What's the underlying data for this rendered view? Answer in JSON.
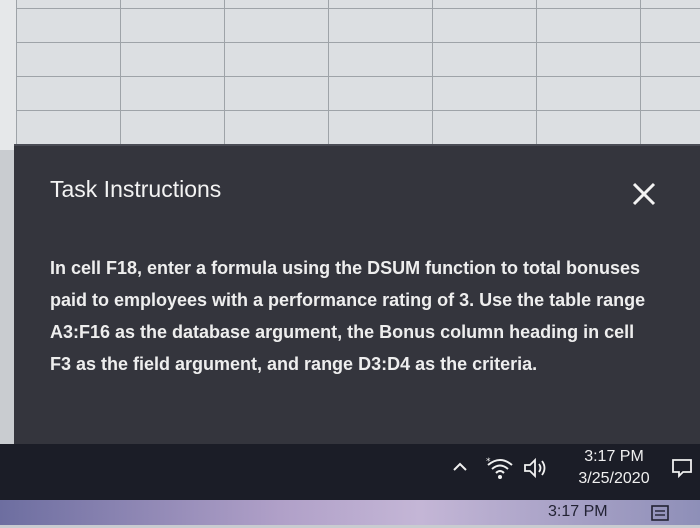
{
  "dialog": {
    "title": "Task Instructions",
    "close_icon": "close-icon",
    "instructions": "In cell F18, enter a formula using the DSUM function to total bonuses paid to employees with a performance rating of 3. Use the table range A3:F16 as the database argument, the Bonus column heading in cell F3 as the field argument, and range D3:D4 as the criteria."
  },
  "taskbar": {
    "time": "3:17 PM",
    "date": "3/25/2020",
    "icons": [
      "chevron-up-icon",
      "wifi-icon",
      "volume-icon",
      "notification-icon"
    ]
  },
  "lower_strip": {
    "time": "3:17 PM"
  }
}
